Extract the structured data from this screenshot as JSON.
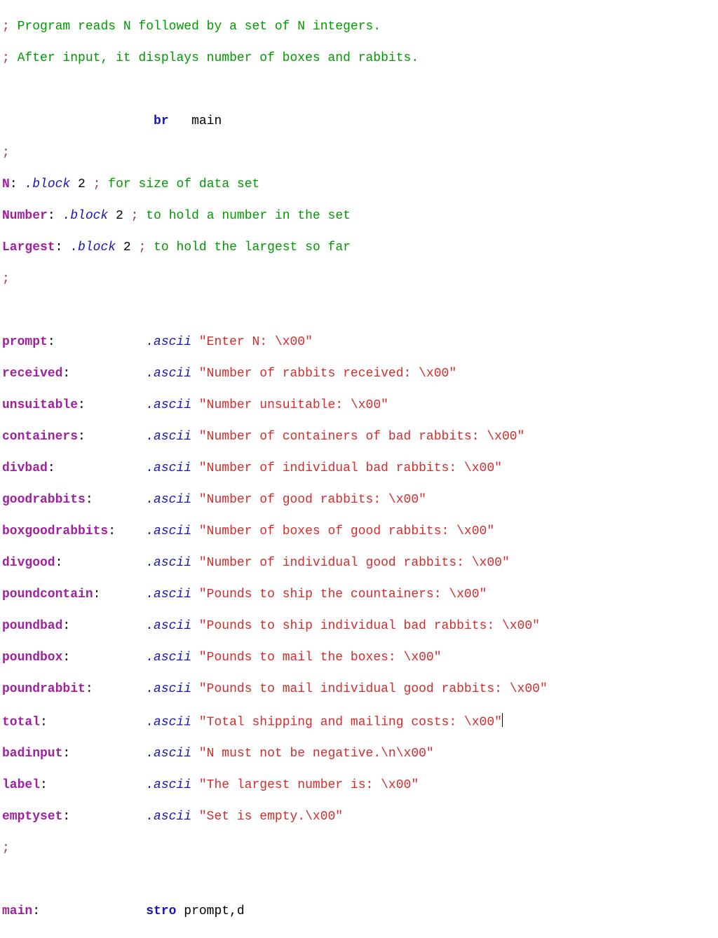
{
  "intro": {
    "line1": "Program reads N followed by a set of N integers.",
    "line2": "After input, it displays number of boxes and rabbits."
  },
  "br_line": {
    "mnemonic": "br",
    "operand": "main"
  },
  "vars": {
    "n": {
      "label": "N",
      "dir": ".block",
      "val": "2",
      "comment": "for size of data set"
    },
    "number": {
      "label": "Number",
      "dir": ".block",
      "val": "2",
      "comment": "to hold a number in the set"
    },
    "largest": {
      "label": "Largest",
      "dir": ".block",
      "val": "2",
      "comment": "to hold the largest so far"
    }
  },
  "strings": {
    "prompt": {
      "label": "prompt",
      "dir": ".ascii",
      "text": "\"Enter N: \\x00\""
    },
    "received": {
      "label": "received",
      "dir": ".ascii",
      "text": "\"Number of rabbits received: \\x00\""
    },
    "unsuitable": {
      "label": "unsuitable",
      "dir": ".ascii",
      "text": "\"Number unsuitable: \\x00\""
    },
    "containers": {
      "label": "containers",
      "dir": ".ascii",
      "text": "\"Number of containers of bad rabbits: \\x00\""
    },
    "divbad": {
      "label": "divbad",
      "dir": ".ascii",
      "text": "\"Number of individual bad rabbits: \\x00\""
    },
    "goodrabbits": {
      "label": "goodrabbits",
      "dir": ".ascii",
      "text": "\"Number of good rabbits: \\x00\""
    },
    "boxgoodrabbits": {
      "label": "boxgoodrabbits",
      "dir": ".ascii",
      "text": "\"Number of boxes of good rabbits: \\x00\""
    },
    "divgood": {
      "label": "divgood",
      "dir": ".ascii",
      "text": "\"Number of individual good rabbits: \\x00\""
    },
    "poundcontain": {
      "label": "poundcontain",
      "dir": ".ascii",
      "text": "\"Pounds to ship the countainers: \\x00\""
    },
    "poundbad": {
      "label": "poundbad",
      "dir": ".ascii",
      "text": "\"Pounds to ship individual bad rabbits: \\x00\""
    },
    "poundbox": {
      "label": "poundbox",
      "dir": ".ascii",
      "text": "\"Pounds to mail the boxes: \\x00\""
    },
    "poundrabbit": {
      "label": "poundrabbit",
      "dir": ".ascii",
      "text": "\"Pounds to mail individual good rabbits: \\x00\""
    },
    "total": {
      "label": "total",
      "dir": ".ascii",
      "text": "\"Total shipping and mailing costs: \\x00\""
    },
    "badinput": {
      "label": "badinput",
      "dir": ".ascii",
      "text": "\"N must not be negative.\\n\\x00\""
    },
    "label": {
      "label": "label",
      "dir": ".ascii",
      "text": "\"The largest number is: \\x00\""
    },
    "emptyset": {
      "label": "emptyset",
      "dir": ".ascii",
      "text": "\"Set is empty.\\x00\""
    }
  },
  "main": {
    "label": "main",
    "mnemonic": "stro",
    "operand": "prompt,d"
  }
}
